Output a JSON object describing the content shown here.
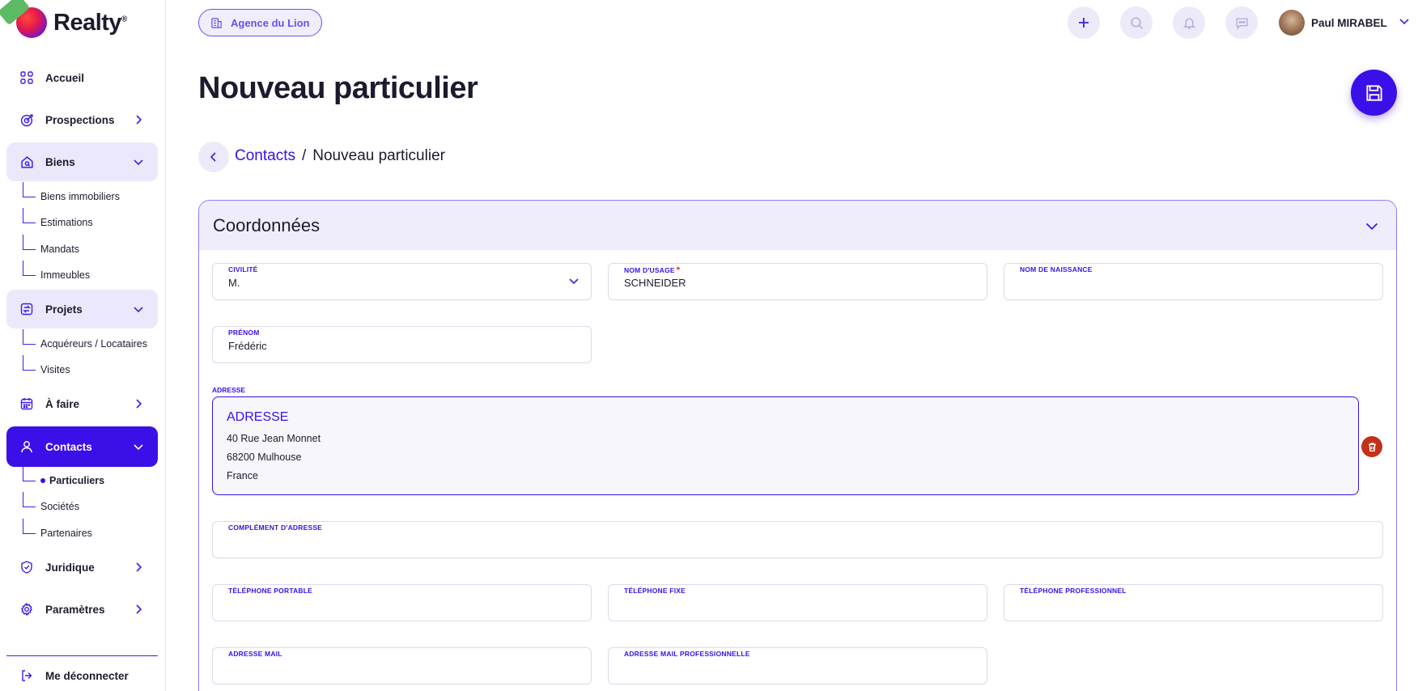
{
  "brand": {
    "name": "Realty",
    "mark": "®"
  },
  "sidebar": {
    "items": [
      {
        "key": "accueil",
        "label": "Accueil"
      },
      {
        "key": "prospections",
        "label": "Prospections"
      },
      {
        "key": "biens",
        "label": "Biens"
      },
      {
        "key": "projets",
        "label": "Projets"
      },
      {
        "key": "a-faire",
        "label": "À faire"
      },
      {
        "key": "contacts",
        "label": "Contacts"
      },
      {
        "key": "juridique",
        "label": "Juridique"
      },
      {
        "key": "parametres",
        "label": "Paramètres"
      },
      {
        "key": "logout",
        "label": "Me déconnecter"
      }
    ],
    "biens_sub": [
      "Biens immobiliers",
      "Estimations",
      "Mandats",
      "Immeubles"
    ],
    "projets_sub": [
      "Acquéreurs / Locataires",
      "Visites"
    ],
    "contacts_sub": [
      "Particuliers",
      "Sociétés",
      "Partenaires"
    ]
  },
  "topbar": {
    "agency": "Agence du Lion",
    "user_name": "Paul MIRABEL"
  },
  "page": {
    "title": "Nouveau particulier",
    "breadcrumb": {
      "parent": "Contacts",
      "separator": "/",
      "current": "Nouveau particulier"
    }
  },
  "form": {
    "section_title": "Coordonnées",
    "civilite": {
      "label": "CIVILITÉ",
      "value": "M."
    },
    "nom_usage": {
      "label": "NOM D'USAGE",
      "required": "*",
      "value": "SCHNEIDER"
    },
    "nom_naissance": {
      "label": "NOM DE NAISSANCE",
      "value": ""
    },
    "prenom": {
      "label": "PRÉNOM",
      "value": "Frédéric"
    },
    "adresse": {
      "label": "ADRESSE",
      "title": "ADRESSE",
      "lines": [
        "40 Rue Jean Monnet",
        "68200 Mulhouse",
        "France"
      ]
    },
    "complement": {
      "label": "COMPLÉMENT D'ADRESSE",
      "value": ""
    },
    "tel_portable": {
      "label": "TÉLÉPHONE PORTABLE",
      "value": ""
    },
    "tel_fixe": {
      "label": "TÉLÉPHONE FIXE",
      "value": ""
    },
    "tel_pro": {
      "label": "TÉLÉPHONE PROFESSIONNEL",
      "value": ""
    },
    "mail": {
      "label": "ADRESSE MAIL",
      "value": ""
    },
    "mail_pro": {
      "label": "ADRESSE MAIL PROFESSIONNELLE",
      "value": ""
    }
  },
  "colors": {
    "primary": "#3b0fe8",
    "accent_light": "#ece8fb",
    "danger": "#c2311b",
    "required": "#e11d48"
  }
}
